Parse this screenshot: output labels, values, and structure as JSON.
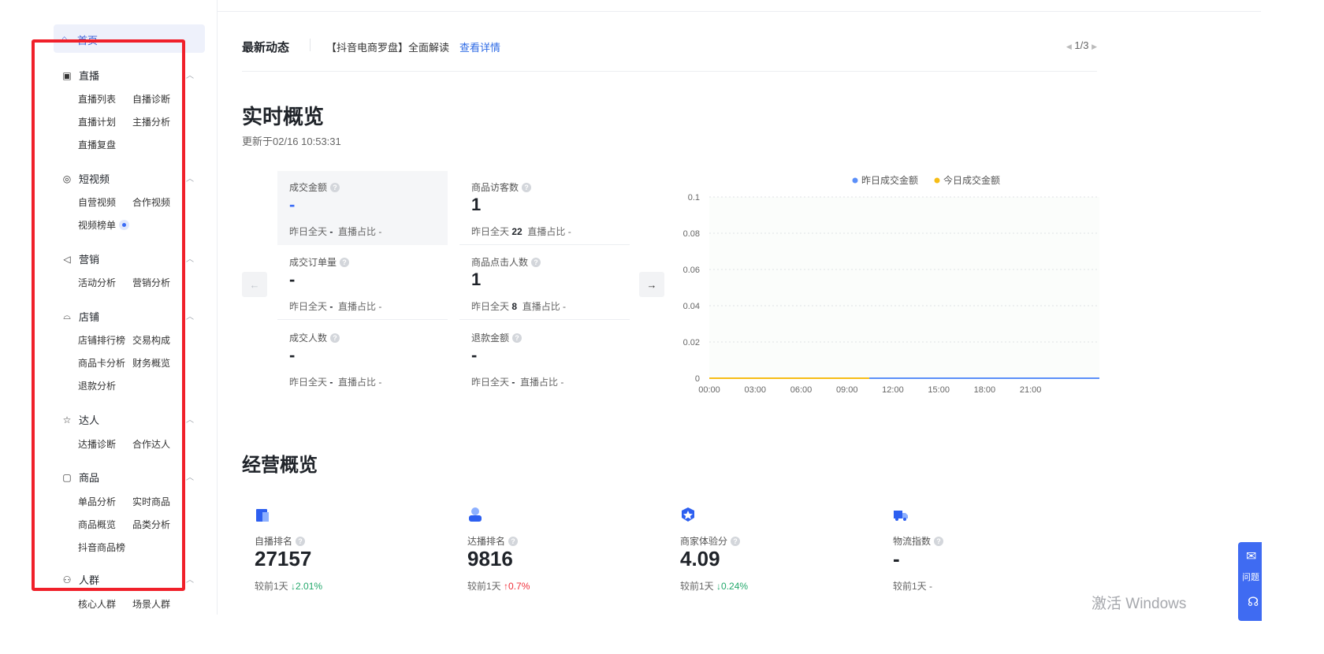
{
  "sidebar": {
    "home": {
      "icon": "home-icon",
      "label": "首页"
    },
    "groups": [
      {
        "icon": "live-icon",
        "label": "直播",
        "items": [
          "直播列表",
          "自播诊断",
          "直播计划",
          "主播分析",
          "直播复盘"
        ]
      },
      {
        "icon": "video-icon",
        "label": "短视频",
        "items": [
          "自营视频",
          "合作视频",
          "视频榜单"
        ]
      },
      {
        "icon": "megaphone-icon",
        "label": "营销",
        "items": [
          "活动分析",
          "营销分析"
        ]
      },
      {
        "icon": "store-icon",
        "label": "店铺",
        "items": [
          "店铺排行榜",
          "交易构成",
          "商品卡分析",
          "财务概览",
          "退款分析"
        ]
      },
      {
        "icon": "influencer-icon",
        "label": "达人",
        "items": [
          "达播诊断",
          "合作达人"
        ]
      },
      {
        "icon": "product-icon",
        "label": "商品",
        "items": [
          "单品分析",
          "实时商品",
          "商品概览",
          "品类分析",
          "抖音商品榜"
        ]
      },
      {
        "icon": "people-icon",
        "label": "人群",
        "items": [
          "核心人群",
          "场景人群"
        ]
      }
    ]
  },
  "news": {
    "title": "最新动态",
    "text": "【抖音电商罗盘】全面解读",
    "link": "查看详情",
    "pager": "1/3"
  },
  "realtime": {
    "title": "实时概览",
    "updated": "更新于02/16 10:53:31",
    "metrics": [
      {
        "label": "成交金额",
        "value": "-",
        "foot_prefix": "昨日全天",
        "foot_value": "-",
        "foot_share": "直播占比 -"
      },
      {
        "label": "商品访客数",
        "value": "1",
        "foot_prefix": "昨日全天",
        "foot_value": "22",
        "foot_share": "直播占比 -"
      },
      {
        "label": "成交订单量",
        "value": "-",
        "foot_prefix": "昨日全天",
        "foot_value": "-",
        "foot_share": "直播占比 -"
      },
      {
        "label": "商品点击人数",
        "value": "1",
        "foot_prefix": "昨日全天",
        "foot_value": "8",
        "foot_share": "直播占比 -"
      },
      {
        "label": "成交人数",
        "value": "-",
        "foot_prefix": "昨日全天",
        "foot_value": "-",
        "foot_share": "直播占比 -"
      },
      {
        "label": "退款金额",
        "value": "-",
        "foot_prefix": "昨日全天",
        "foot_value": "-",
        "foot_share": "直播占比 -"
      }
    ]
  },
  "chart_data": {
    "type": "line",
    "x": [
      "00:00",
      "03:00",
      "06:00",
      "09:00",
      "12:00",
      "15:00",
      "18:00",
      "21:00"
    ],
    "ylim": [
      0,
      0.1
    ],
    "yticks": [
      "0",
      "0.02",
      "0.04",
      "0.06",
      "0.08",
      "0.1"
    ],
    "grid": true,
    "legend_position": "top",
    "series": [
      {
        "name": "昨日成交金额",
        "color": "#5b8ff9",
        "values": [
          0,
          0,
          0,
          0,
          0,
          0,
          0,
          0,
          0
        ]
      },
      {
        "name": "今日成交金额",
        "color": "#f6bd16",
        "values": [
          0,
          0,
          0,
          0
        ]
      }
    ]
  },
  "business": {
    "title": "经营概览",
    "cards": [
      {
        "icon": "rank-icon",
        "label": "自播排名",
        "value": "27157",
        "foot": "较前1天",
        "trend": "down",
        "change": "2.01%"
      },
      {
        "icon": "influencer-rank-icon",
        "label": "达播排名",
        "value": "9816",
        "foot": "较前1天",
        "trend": "up",
        "change": "0.7%"
      },
      {
        "icon": "merchant-score-icon",
        "label": "商家体验分",
        "value": "4.09",
        "foot": "较前1天",
        "trend": "down",
        "change": "0.24%"
      },
      {
        "icon": "logistics-icon",
        "label": "物流指数",
        "value": "-",
        "foot": "较前1天 -",
        "trend": "",
        "change": ""
      }
    ]
  },
  "float": {
    "label": "问题"
  },
  "watermark": "激活 Windows"
}
